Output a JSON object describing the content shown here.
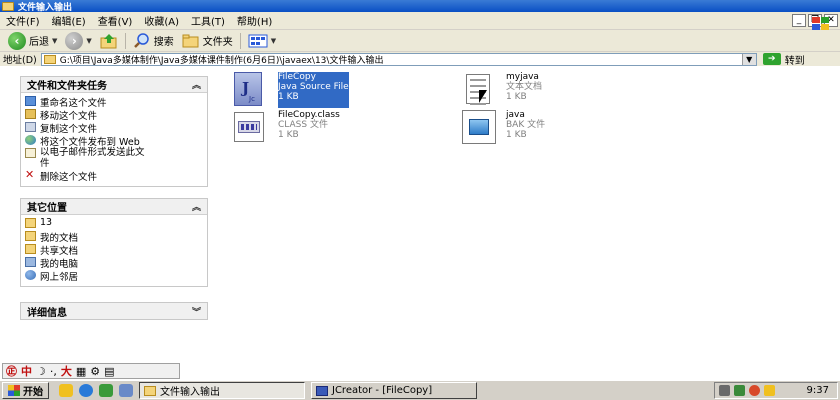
{
  "window": {
    "title": "文件输入输出"
  },
  "menu": [
    "文件(F)",
    "编辑(E)",
    "查看(V)",
    "收藏(A)",
    "工具(T)",
    "帮助(H)"
  ],
  "toolbar": {
    "back_label": "后退",
    "search_label": "搜索",
    "folders_label": "文件夹"
  },
  "address": {
    "label": "地址(D)",
    "path": "G:\\项目\\Java多媒体制作\\Java多媒体课件制作(6月6日)\\javaex\\13\\文件输入输出",
    "go_label": "转到"
  },
  "sidebar": {
    "tasks": {
      "title": "文件和文件夹任务",
      "items": [
        {
          "label": "重命名这个文件",
          "icon": "rename-icon"
        },
        {
          "label": "移动这个文件",
          "icon": "move-icon"
        },
        {
          "label": "复制这个文件",
          "icon": "copy-icon"
        },
        {
          "label": "将这个文件发布到 Web",
          "icon": "globe-icon"
        },
        {
          "label": "以电子邮件形式发送此文件",
          "icon": "mail-icon"
        },
        {
          "label": "删除这个文件",
          "icon": "delete-icon"
        }
      ]
    },
    "places": {
      "title": "其它位置",
      "items": [
        {
          "label": "13",
          "icon": "folder-icon"
        },
        {
          "label": "我的文档",
          "icon": "folder-icon"
        },
        {
          "label": "共享文档",
          "icon": "folder-icon"
        },
        {
          "label": "我的电脑",
          "icon": "computer-icon"
        },
        {
          "label": "网上邻居",
          "icon": "network-icon"
        }
      ]
    },
    "details": {
      "title": "详细信息"
    }
  },
  "files": [
    {
      "name": "FileCopy",
      "type": "Java Source File",
      "size": "1 KB",
      "icon": "java-file-icon",
      "selected": true
    },
    {
      "name": "myjava",
      "type": "文本文档",
      "size": "1 KB",
      "icon": "text-file-icon",
      "selected": false
    },
    {
      "name": "FileCopy.class",
      "type": "CLASS 文件",
      "size": "1 KB",
      "icon": "class-file-icon",
      "selected": false
    },
    {
      "name": "java",
      "type": "BAK 文件",
      "size": "1 KB",
      "icon": "bak-file-icon",
      "selected": false
    }
  ],
  "ime": {
    "label": "中"
  },
  "taskbar": {
    "start_label": "开始",
    "tasks": [
      "文件输入输出",
      "JCreator - [FileCopy]"
    ],
    "clock": "9:37"
  },
  "colors": {
    "titlebar": "#0a4fc4",
    "selection": "#316ac5",
    "chrome": "#ece9d8",
    "taskbar": "#d4d0c8"
  }
}
